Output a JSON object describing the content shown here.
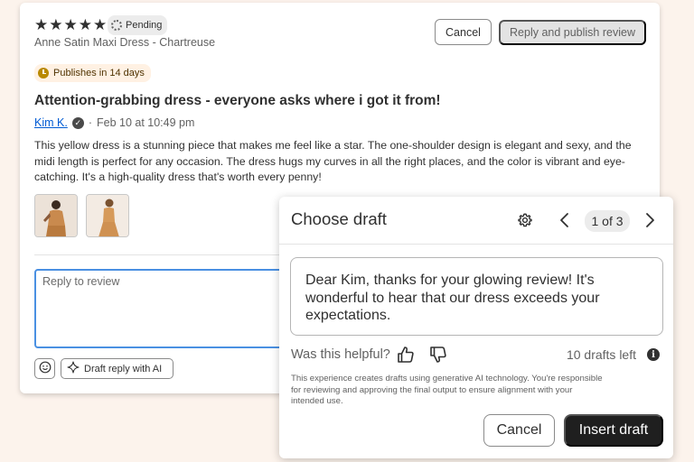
{
  "review": {
    "rating": 5,
    "status": "Pending",
    "product": "Anne Satin Maxi Dress - Chartreuse",
    "publish_notice": "Publishes in 14 days",
    "title": "Attention-grabbing dress - everyone asks where i got it from!",
    "reviewer": "Kim K.",
    "separator": "·",
    "date": "Feb 10 at 10:49 pm",
    "body": "This yellow dress is a stunning piece that makes me feel like a star. The one-shoulder design is elegant and sexy, and the midi length is perfect for any occasion. The dress hugs my curves in all the right places, and the color is vibrant and eye-catching. It's a high-quality dress that's worth every penny!"
  },
  "actions": {
    "cancel": "Cancel",
    "publish": "Reply and publish review"
  },
  "reply": {
    "placeholder": "Reply to review",
    "draft_ai_label": "Draft reply with AI"
  },
  "draft_panel": {
    "title": "Choose draft",
    "counter": "1 of 3",
    "draft_text": "Dear Kim, thanks for your glowing review! It's wonderful to hear that our dress exceeds your expectations.",
    "helpful_label": "Was this helpful?",
    "drafts_left": "10 drafts left",
    "disclaimer": "This experience creates drafts using generative AI technology. You're responsible for reviewing and approving the final output to ensure alignment with your intended use.",
    "cancel": "Cancel",
    "insert": "Insert draft"
  },
  "icons": {
    "star": "star-icon",
    "pending": "pending-icon",
    "clock": "clock-icon",
    "verified": "verified-icon",
    "emoji": "emoji-icon",
    "sparkle": "sparkle-icon",
    "gear": "gear-icon",
    "chevron_left": "chevron-left-icon",
    "chevron_right": "chevron-right-icon",
    "thumbs_up": "thumbs-up-icon",
    "thumbs_down": "thumbs-down-icon",
    "info": "info-icon"
  },
  "colors": {
    "background": "#fcf3ec",
    "link": "#005bd3",
    "primary_button": "#1f1f1f",
    "focus_border": "#4a90e2",
    "publish_badge": "#fff1e3"
  }
}
